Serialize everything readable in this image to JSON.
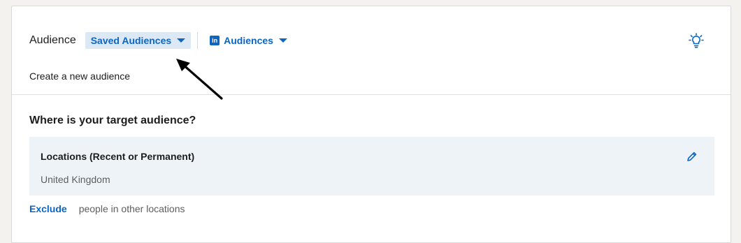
{
  "header": {
    "audience_label": "Audience",
    "saved_audiences_label": "Saved Audiences",
    "linkedin_logo_text": "in",
    "audiences_label": "Audiences",
    "tips_icon": "lightbulb-icon"
  },
  "subtitle": "Create a new audience",
  "location_section": {
    "question": "Where is your target audience?",
    "card_title": "Locations (Recent or Permanent)",
    "card_value": "United Kingdom",
    "edit_icon": "pencil-icon",
    "exclude_label": "Exclude",
    "exclude_text": "people in other locations"
  },
  "annotation": {
    "arrow_icon": "arrow-icon"
  },
  "colors": {
    "accent": "#0a66c2",
    "saved_bg": "#dce9f5",
    "location_bg": "#eef3f8"
  }
}
